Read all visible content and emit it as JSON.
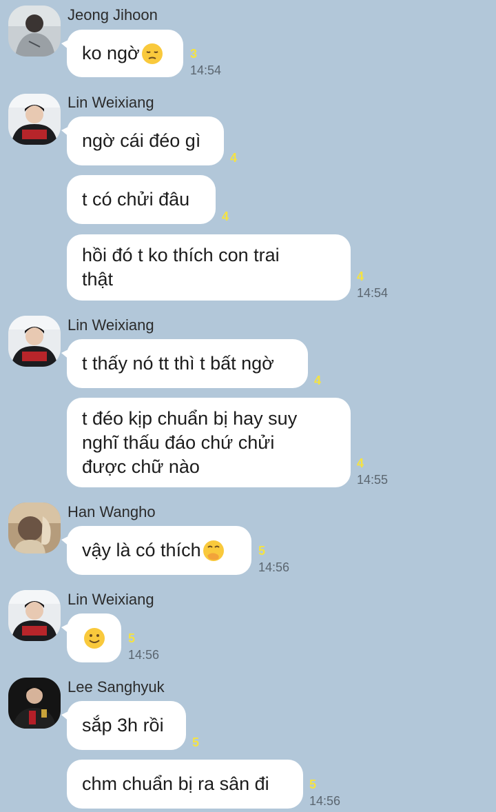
{
  "messages": [
    {
      "sender": "Jeong Jihoon",
      "text": "ko ngờ",
      "emoji": "pensive-face-emoji",
      "count": "3",
      "time": "14:54"
    },
    {
      "sender": "Lin Weixiang",
      "text": "ngờ cái đéo gì",
      "count": "4"
    },
    {
      "text": "t có chửi đâu",
      "count": "4"
    },
    {
      "line1": "hồi đó t ko thích con trai",
      "line2": "thật",
      "count": "4",
      "time": "14:54"
    },
    {
      "sender": "Lin Weixiang",
      "text": "t thấy nó tt thì t bất ngờ",
      "count": "4"
    },
    {
      "line1": "t đéo kịp chuẩn bị hay suy",
      "line2": "nghĩ thấu đáo chứ chửi",
      "line3": "được chữ nào",
      "count": "4",
      "time": "14:55"
    },
    {
      "sender": "Han Wangho",
      "text": "vậy là có thích",
      "emoji": "hand-over-mouth-emoji",
      "count": "5",
      "time": "14:56"
    },
    {
      "sender": "Lin Weixiang",
      "emoji": "slightly-smiling-face-emoji",
      "count": "5",
      "time": "14:56"
    },
    {
      "sender": "Lee Sanghyuk",
      "text": "sắp 3h rồi",
      "count": "5"
    },
    {
      "text": "chm chuẩn bị ra sân đi",
      "count": "5",
      "time": "14:56"
    }
  ],
  "colors": {
    "background": "#b2c7d9",
    "bubble": "#ffffff",
    "unread_count": "#f5e342",
    "time": "#5b6670"
  }
}
